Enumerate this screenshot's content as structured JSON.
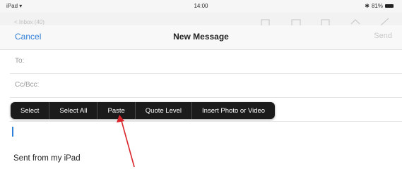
{
  "status_bar": {
    "device": "iPad",
    "wifi_icon": "wifi-icon",
    "time": "14:00",
    "battery": "81%",
    "battery_icon": "battery-icon"
  },
  "nav": {
    "cancel": "Cancel",
    "title": "New Message",
    "send": "Send"
  },
  "fields": {
    "to": "To:",
    "cc_bcc": "Cc/Bcc:"
  },
  "edit_menu": {
    "items": [
      "Select",
      "Select All",
      "Paste",
      "Quote Level",
      "Insert Photo or Video"
    ]
  },
  "body": {
    "signature": "Sent from my iPad"
  },
  "annotation": {
    "arrow_color": "#d9252b",
    "points_to": "Paste"
  },
  "colors": {
    "accent": "#2f7fd8",
    "menu_background": "#1b1b1b"
  }
}
